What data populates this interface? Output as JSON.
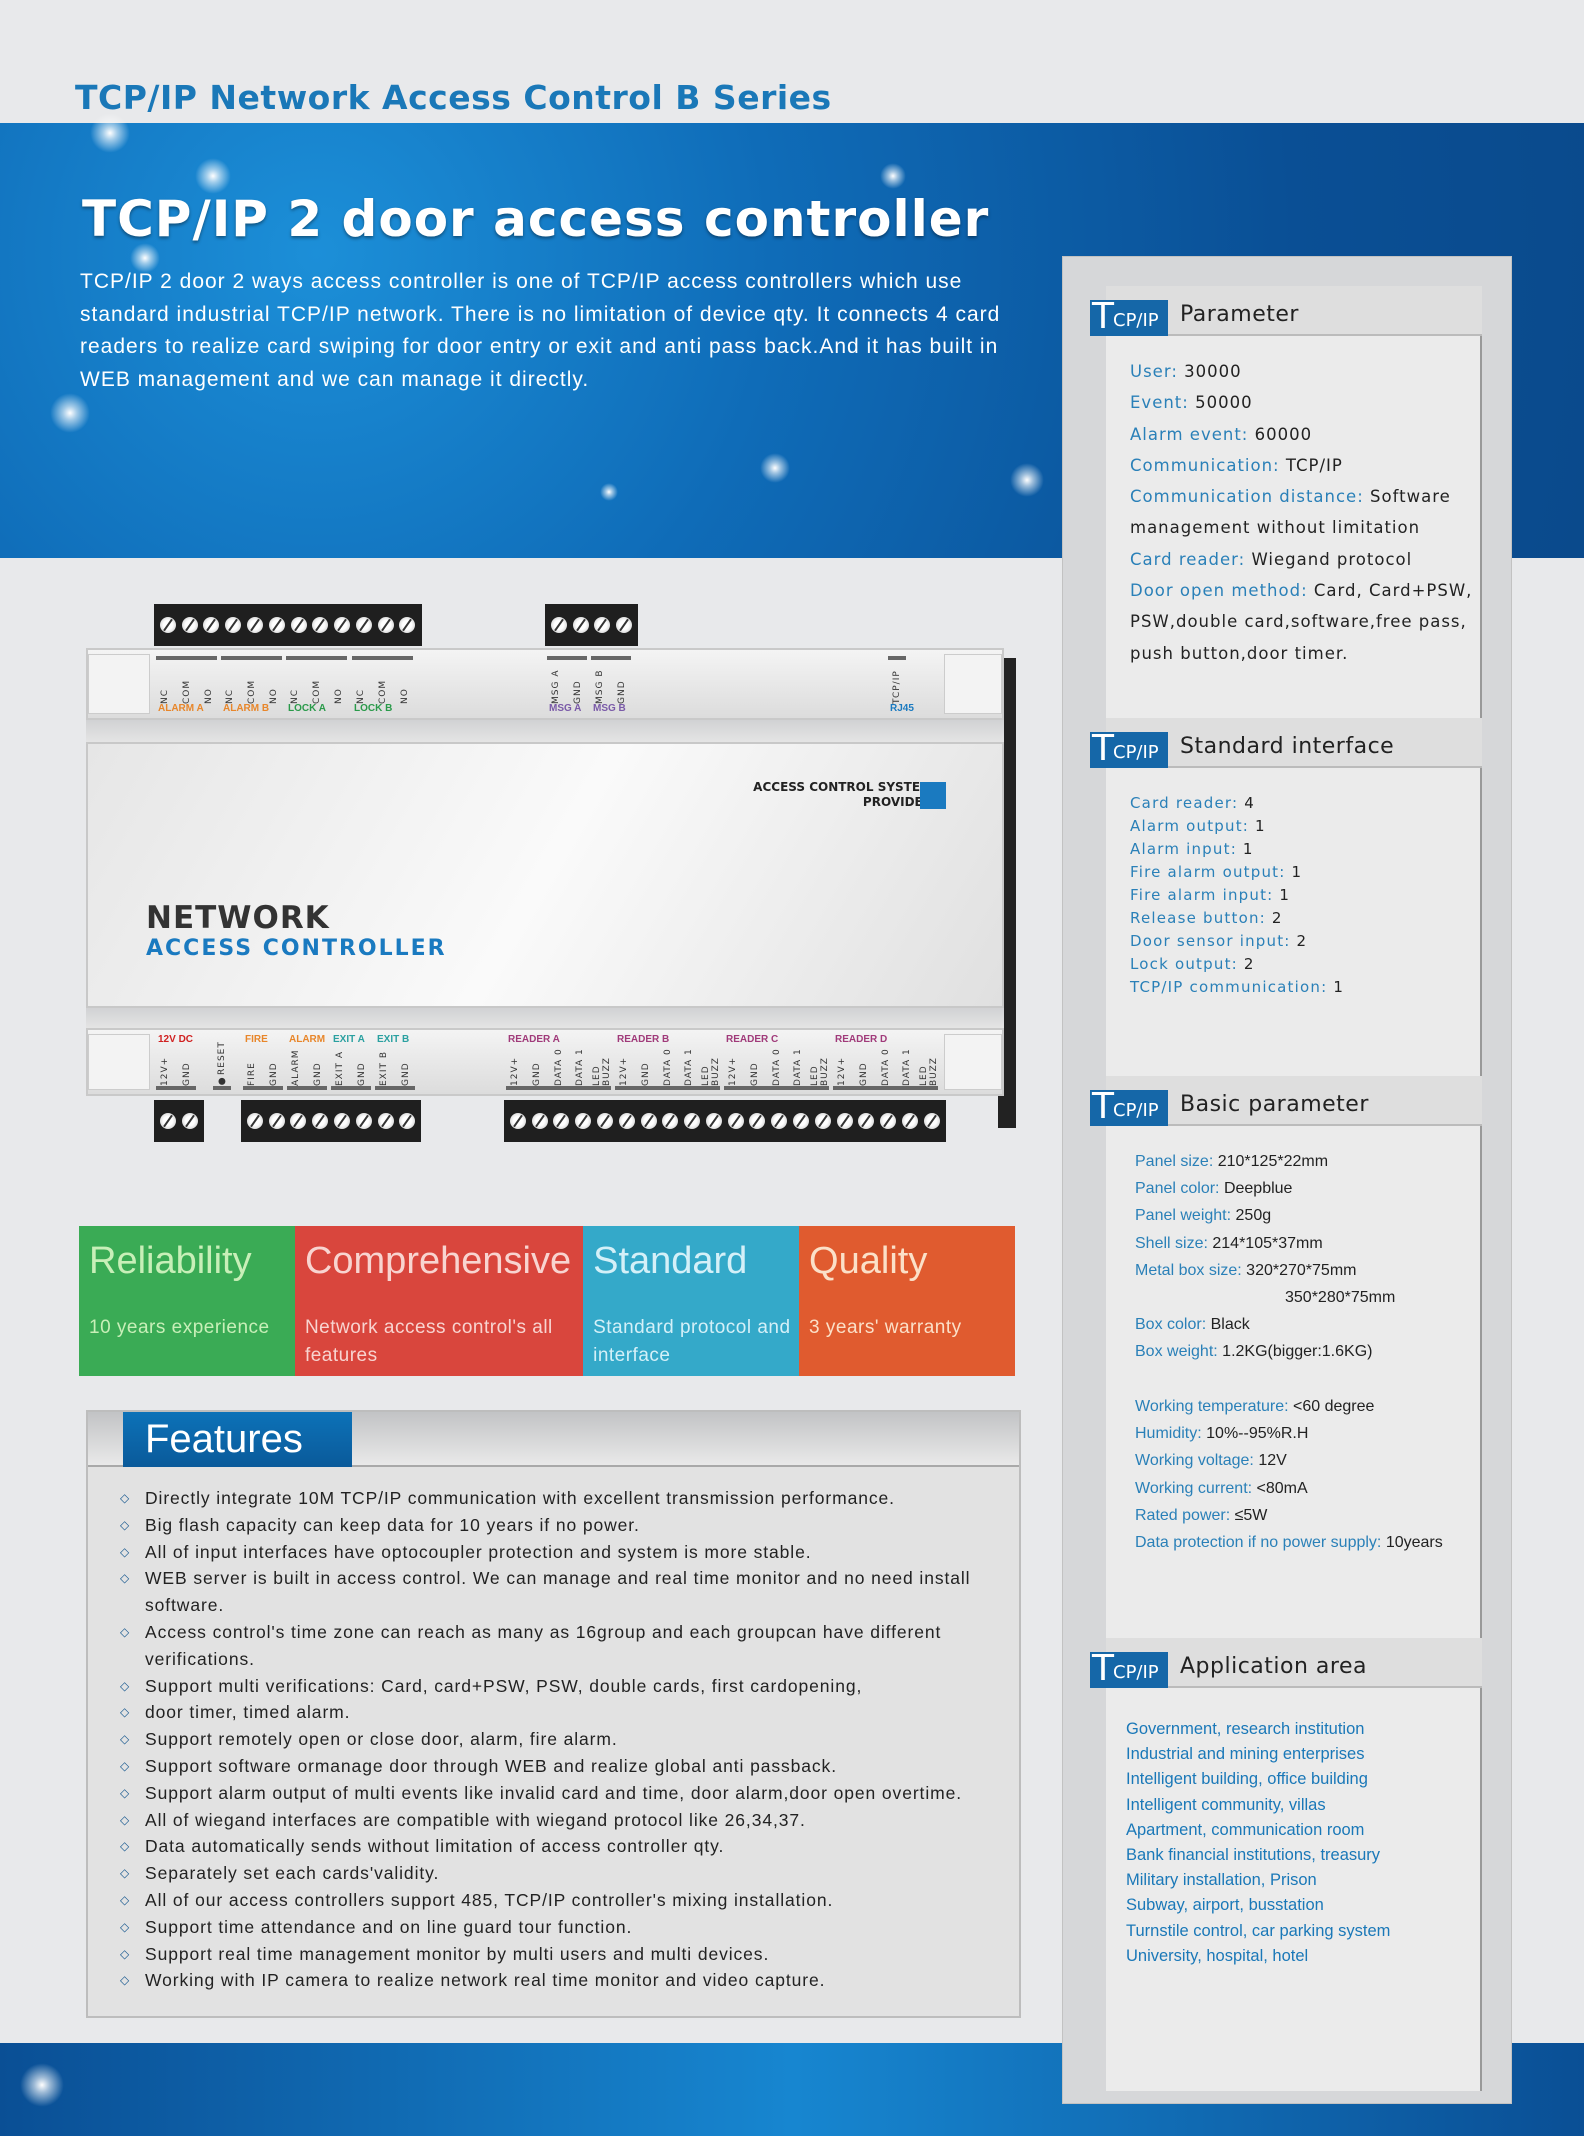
{
  "header": {
    "series_title": "TCP/IP Network Access Control  B  Series"
  },
  "hero": {
    "title": "TCP/IP 2 door access controller",
    "intro": "TCP/IP 2 door 2 ways access controller is one of TCP/IP access controllers which use standard industrial TCP/IP network. There is no limitation of device qty. It connects 4 card readers to realize card swiping for door entry or exit and anti pass back.And it has built in WEB management and we can manage it directly."
  },
  "device": {
    "name": "NETWORK",
    "subtitle": "ACCESS CONTROLLER",
    "provider_line1": "ACCESS CONTROL SYSTEM",
    "provider_line2": "PROVIDER",
    "top_groups": [
      {
        "label": "ALARM A",
        "color": "#e8862a",
        "pins": [
          "NC",
          "COM",
          "NO"
        ]
      },
      {
        "label": "ALARM B",
        "color": "#e8862a",
        "pins": [
          "NC",
          "COM",
          "NO"
        ]
      },
      {
        "label": "LOCK A",
        "color": "#2a9a4a",
        "pins": [
          "NC",
          "COM",
          "NO"
        ]
      },
      {
        "label": "LOCK B",
        "color": "#2a9a4a",
        "pins": [
          "NC",
          "COM",
          "NO"
        ]
      },
      {
        "label": "MSG A",
        "color": "#7a5aa8",
        "pins": [
          "MSG A",
          "GND"
        ]
      },
      {
        "label": "MSG B",
        "color": "#7a5aa8",
        "pins": [
          "MSG B",
          "GND"
        ]
      },
      {
        "label": "RJ45",
        "color": "#1a7ac0",
        "pins": [
          "TCP/IP"
        ]
      }
    ],
    "bottom_groups": [
      {
        "label": "12V DC",
        "color": "#d02020",
        "pins": [
          "12V+",
          "GND"
        ]
      },
      {
        "label": "",
        "color": "#333333",
        "pins": [
          "●RESET"
        ]
      },
      {
        "label": "FIRE",
        "color": "#e8862a",
        "pins": [
          "FIRE",
          "GND"
        ]
      },
      {
        "label": "ALARM",
        "color": "#e8862a",
        "pins": [
          "ALARM",
          "GND"
        ]
      },
      {
        "label": "EXIT A",
        "color": "#2aa0a0",
        "pins": [
          "EXIT A",
          "GND"
        ]
      },
      {
        "label": "EXIT B",
        "color": "#2aa0a0",
        "pins": [
          "EXIT B",
          "GND"
        ]
      },
      {
        "label": "READER A",
        "color": "#a03a7a",
        "pins": [
          "12V+",
          "GND",
          "DATA 0",
          "DATA 1",
          "LED BUZZ"
        ]
      },
      {
        "label": "READER B",
        "color": "#a03a7a",
        "pins": [
          "12V+",
          "GND",
          "DATA 0",
          "DATA 1",
          "LED BUZZ"
        ]
      },
      {
        "label": "READER C",
        "color": "#a03a7a",
        "pins": [
          "12V+",
          "GND",
          "DATA 0",
          "DATA 1",
          "LED BUZZ"
        ]
      },
      {
        "label": "READER D",
        "color": "#a03a7a",
        "pins": [
          "12V+",
          "GND",
          "DATA 0",
          "DATA 1",
          "LED BUZZ"
        ]
      }
    ]
  },
  "tiles": [
    {
      "title": "Reliability",
      "subtitle": "10 years experience",
      "bg": "#3aab55",
      "title_color": "#c8efb8"
    },
    {
      "title": "Comprehensive",
      "subtitle": "Network access control's all features",
      "bg": "#d9463d",
      "title_color": "#f8d4d0"
    },
    {
      "title": "Standard",
      "subtitle": "Standard protocol and interface",
      "bg": "#34a9c9",
      "title_color": "#d4f0f8"
    },
    {
      "title": "Quality",
      "subtitle": "3 years' warranty",
      "bg": "#e05b2f",
      "title_color": "#fbe0c8"
    }
  ],
  "features": {
    "title": "Features",
    "items": [
      "Directly integrate 10M TCP/IP communication with excellent transmission performance.",
      "Big flash capacity can keep data for 10 years if no power.",
      "All of input interfaces have optocoupler protection and system is more stable.",
      "WEB server is built in access control. We can manage and real time monitor and no need install software.",
      "Access control's time zone can reach as many as 16group and each groupcan have different verifications.",
      "Support multi verifications: Card, card+PSW, PSW, double cards, first cardopening,",
      "door timer, timed alarm.",
      "Support remotely open or close door, alarm, fire alarm.",
      "Support software ormanage door through WEB and realize global anti passback.",
      "Support alarm output of multi events like invalid card and time, door alarm,door open overtime.",
      "All of wiegand interfaces are compatible with wiegand protocol like 26,34,37.",
      "Data automatically sends without limitation of access controller qty.",
      "Separately set each cards'validity.",
      "All of our access controllers support 485, TCP/IP controller's mixing installation.",
      "Support time attendance and on line guard tour function.",
      "Support real time management monitor by multi users and multi devices.",
      "Working with IP camera to realize network real time monitor and video capture."
    ]
  },
  "logo": {
    "big": "T",
    "small": "CP/IP"
  },
  "parameter": {
    "title": "Parameter",
    "items": [
      {
        "label": "User:",
        "value": "30000"
      },
      {
        "label": "Event:",
        "value": "50000"
      },
      {
        "label": "Alarm event:",
        "value": "60000"
      },
      {
        "label": "Communication:",
        "value": "TCP/IP"
      },
      {
        "label": "Communication distance:",
        "value": "Software management without limitation"
      },
      {
        "label": "Card reader:",
        "value": "Wiegand protocol"
      },
      {
        "label": "Door open method:",
        "value": "Card, Card+PSW, PSW,double card,software,free pass, push button,door timer."
      }
    ]
  },
  "standard_interface": {
    "title": "Standard  interface",
    "items": [
      {
        "label": "Card reader:",
        "value": "4"
      },
      {
        "label": "Alarm output:",
        "value": "1"
      },
      {
        "label": "Alarm input:",
        "value": "1"
      },
      {
        "label": "Fire alarm output:",
        "value": "1"
      },
      {
        "label": "Fire alarm input:",
        "value": "1"
      },
      {
        "label": "Release button:",
        "value": "2"
      },
      {
        "label": "Door sensor input:",
        "value": "2"
      },
      {
        "label": "Lock output:",
        "value": "2"
      },
      {
        "label": "TCP/IP communication:",
        "value": "1"
      }
    ]
  },
  "basic_parameter": {
    "title": "Basic parameter",
    "group1": [
      {
        "label": "Panel size:",
        "value": "210*125*22mm"
      },
      {
        "label": "Panel color:",
        "value": "Deepblue"
      },
      {
        "label": "Panel weight:",
        "value": "250g"
      },
      {
        "label": "Shell size:",
        "value": "214*105*37mm"
      },
      {
        "label": "Metal box size:",
        "value": "320*270*75mm",
        "value2": "350*280*75mm"
      },
      {
        "label": "Box color:",
        "value": "Black"
      },
      {
        "label": "Box weight:",
        "value": "1.2KG(bigger:1.6KG)"
      }
    ],
    "group2": [
      {
        "label": "Working temperature:",
        "value": "<60 degree"
      },
      {
        "label": "Humidity:",
        "value": "10%--95%R.H"
      },
      {
        "label": "Working voltage:",
        "value": "12V"
      },
      {
        "label": "Working current:",
        "value": "<80mA"
      },
      {
        "label": "Rated power:",
        "value": "≤5W"
      },
      {
        "label": "Data protection if no power supply:",
        "value": "10years"
      }
    ]
  },
  "application_area": {
    "title": "Application  area",
    "items": [
      "Government, research institution",
      "Industrial and mining enterprises",
      "Intelligent building, office building",
      "Intelligent community, villas",
      "Apartment, communication room",
      "Bank financial institutions, treasury",
      "Military installation, Prison",
      "Subway, airport, busstation",
      "Turnstile control, car parking system",
      "University, hospital, hotel"
    ]
  }
}
